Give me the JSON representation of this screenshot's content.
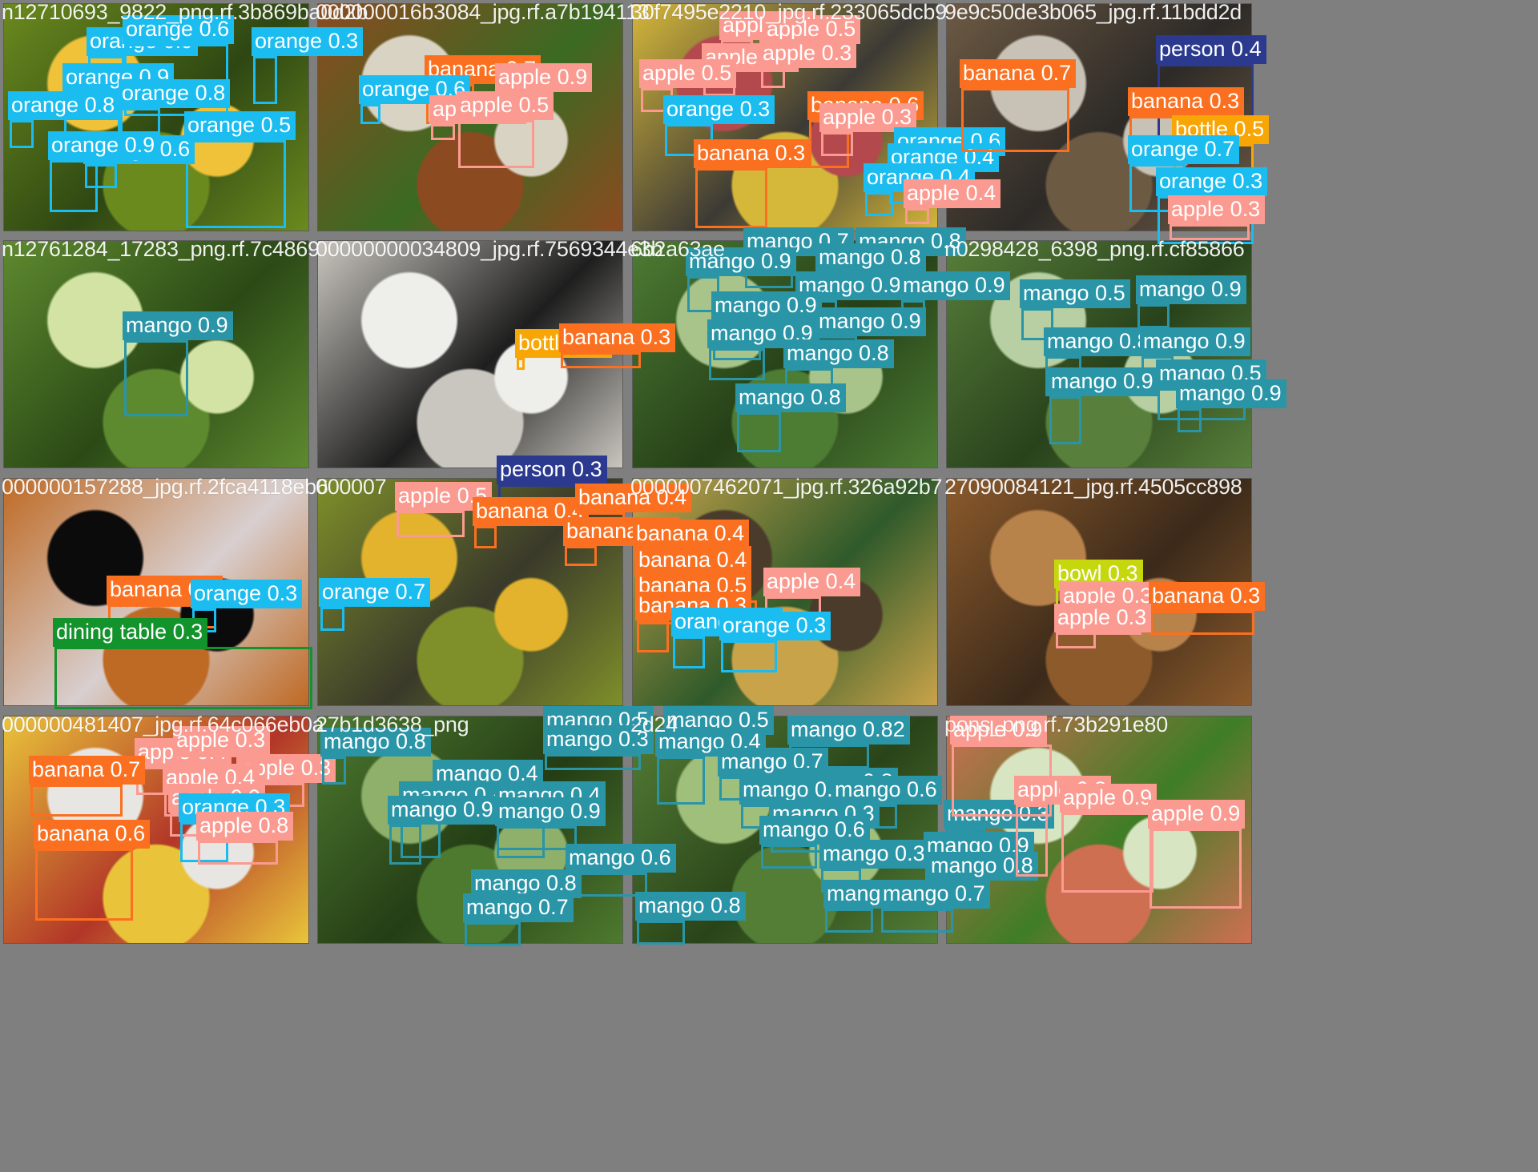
{
  "colors": {
    "orange": "#1bbcf0",
    "banana": "#fb7020",
    "apple": "#fb9a90",
    "mango": "#2a95a7",
    "person": "#2b3a8f",
    "bottle": "#f8a606",
    "bowl": "#c6d70e",
    "dining table": "#13932b"
  },
  "tiles": [
    {
      "filename": "n12710693_9822_png.rf.3b869ba0d2b",
      "photo": [
        "#f0c23a",
        "#6b8a1e",
        "#2e4713"
      ],
      "detections": [
        {
          "label": "orange 0.9",
          "cls": "orange"
        },
        {
          "label": "orange 0.3",
          "cls": "orange"
        },
        {
          "label": "orange 0.6",
          "cls": "orange"
        },
        {
          "label": "orange 0.9",
          "cls": "orange"
        },
        {
          "label": "orange 0.8",
          "cls": "orange"
        },
        {
          "label": "orange 0.8",
          "cls": "orange"
        },
        {
          "label": "orange 0.5",
          "cls": "orange"
        },
        {
          "label": "orange 0.6",
          "cls": "orange"
        },
        {
          "label": "orange 0.9",
          "cls": "orange"
        }
      ]
    },
    {
      "filename": "000000016b3084_jpg.rf.a7b194113",
      "photo": [
        "#d9d3c4",
        "#8c4a20",
        "#3b6a22"
      ],
      "detections": [
        {
          "label": "banana 0.7",
          "cls": "banana"
        },
        {
          "label": "orange 0.6",
          "cls": "orange"
        },
        {
          "label": "apple 0.4",
          "cls": "apple"
        },
        {
          "label": "apple 0.9",
          "cls": "apple"
        },
        {
          "label": "apple 0.5",
          "cls": "apple"
        }
      ]
    },
    {
      "filename": "30f7495e2210_jpg.rf.233065dcb9",
      "photo": [
        "#b4494d",
        "#d5b73a",
        "#3c3a35"
      ],
      "detections": [
        {
          "label": "apple 0.5",
          "cls": "apple"
        },
        {
          "label": "apple 0.5",
          "cls": "apple"
        },
        {
          "label": "apple 0.3",
          "cls": "apple"
        },
        {
          "label": "apple 0.3",
          "cls": "apple"
        },
        {
          "label": "apple 0.5",
          "cls": "apple"
        },
        {
          "label": "orange 0.3",
          "cls": "orange"
        },
        {
          "label": "banana 0.6",
          "cls": "banana"
        },
        {
          "label": "apple 0.3",
          "cls": "apple"
        },
        {
          "label": "banana 0.3",
          "cls": "banana"
        },
        {
          "label": "orange 0.6",
          "cls": "orange"
        },
        {
          "label": "orange 0.4",
          "cls": "orange"
        },
        {
          "label": "orange 0.4",
          "cls": "orange"
        },
        {
          "label": "apple 0.4",
          "cls": "apple"
        }
      ]
    },
    {
      "filename": "9e9c50de3b065_jpg.rf.11bdd2d",
      "photo": [
        "#c8c2b6",
        "#6d5a43",
        "#2d2a27"
      ],
      "detections": [
        {
          "label": "banana 0.7",
          "cls": "banana"
        },
        {
          "label": "person 0.4",
          "cls": "person"
        },
        {
          "label": "banana 0.3",
          "cls": "banana"
        },
        {
          "label": "bottle 0.5",
          "cls": "bottle"
        },
        {
          "label": "orange 0.7",
          "cls": "orange"
        },
        {
          "label": "orange 0.3",
          "cls": "orange"
        },
        {
          "label": "apple 0.3",
          "cls": "apple"
        }
      ]
    },
    {
      "filename": "n12761284_17283_png.rf.7c4869",
      "photo": [
        "#d2e3a4",
        "#5e8a2f",
        "#2b4a16"
      ],
      "detections": [
        {
          "label": "mango 0.9",
          "cls": "mango"
        }
      ]
    },
    {
      "filename": "00000000034809_jpg.rf.7569344e3b",
      "photo": [
        "#eeeeea",
        "#c9c6bf",
        "#1e1e1e"
      ],
      "detections": [
        {
          "label": "bottle 0.3",
          "cls": "bottle"
        },
        {
          "label": "banana 0.3",
          "cls": "banana"
        }
      ]
    },
    {
      "filename": "6b2a63ae",
      "photo": [
        "#a9c48a",
        "#4d7c33",
        "#253f17"
      ],
      "detections": [
        {
          "label": "mango 0.7",
          "cls": "mango"
        },
        {
          "label": "mango 0.8",
          "cls": "mango"
        },
        {
          "label": "mango 0.9",
          "cls": "mango"
        },
        {
          "label": "mango 0.8",
          "cls": "mango"
        },
        {
          "label": "mango 0.9",
          "cls": "mango"
        },
        {
          "label": "mango 0.9",
          "cls": "mango"
        },
        {
          "label": "mango 0.9",
          "cls": "mango"
        },
        {
          "label": "mango 0.9",
          "cls": "mango"
        },
        {
          "label": "mango 0.9",
          "cls": "mango"
        },
        {
          "label": "mango 0.8",
          "cls": "mango"
        },
        {
          "label": "mango 0.8",
          "cls": "mango"
        }
      ]
    },
    {
      "filename": "n0298428_6398_png.rf.cf85866",
      "photo": [
        "#b7cfa2",
        "#587f3b",
        "#28421b"
      ],
      "detections": [
        {
          "label": "mango 0.5",
          "cls": "mango"
        },
        {
          "label": "mango 0.9",
          "cls": "mango"
        },
        {
          "label": "mango 0.8",
          "cls": "mango"
        },
        {
          "label": "mango 0.9",
          "cls": "mango"
        },
        {
          "label": "mango 0.5",
          "cls": "mango"
        },
        {
          "label": "mango 0.9",
          "cls": "mango"
        },
        {
          "label": "mango 0.9",
          "cls": "mango"
        }
      ]
    },
    {
      "filename": "000000157288_jpg.rf.2fca4118eb6",
      "photo": [
        "#0b0b0b",
        "#bf6a24",
        "#d8cfcf"
      ],
      "detections": [
        {
          "label": "banana 0.4",
          "cls": "banana"
        },
        {
          "label": "orange 0.3",
          "cls": "orange"
        },
        {
          "label": "orange 0.7",
          "cls": "orange"
        },
        {
          "label": "dining table 0.3",
          "cls": "dining table"
        }
      ]
    },
    {
      "filename": "000007",
      "photo": [
        "#e3b32d",
        "#7f8f2a",
        "#3a3a2a"
      ],
      "detections": [
        {
          "label": "person 0.3",
          "cls": "person"
        },
        {
          "label": "apple 0.5",
          "cls": "apple"
        },
        {
          "label": "banana 0.4",
          "cls": "banana"
        },
        {
          "label": "banana 0.4",
          "cls": "banana"
        },
        {
          "label": "banana 0.5",
          "cls": "banana"
        }
      ]
    },
    {
      "filename": "0000007462071_jpg.rf.326a92b7",
      "photo": [
        "#4b3b2b",
        "#c9a34a",
        "#2f5a2a"
      ],
      "detections": [
        {
          "label": "banana 0.4",
          "cls": "banana"
        },
        {
          "label": "banana 0.4",
          "cls": "banana"
        },
        {
          "label": "banana 0.5",
          "cls": "banana"
        },
        {
          "label": "apple 0.4",
          "cls": "apple"
        },
        {
          "label": "banana 0.3",
          "cls": "banana"
        },
        {
          "label": "orange 0.3",
          "cls": "orange"
        },
        {
          "label": "orange 0.3",
          "cls": "orange"
        }
      ]
    },
    {
      "filename": "27090084121_jpg.rf.4505cc898",
      "photo": [
        "#b8824b",
        "#8c5a2b",
        "#3b2a1a"
      ],
      "detections": [
        {
          "label": "bowl 0.3",
          "cls": "bowl"
        },
        {
          "label": "apple 0.3",
          "cls": "apple"
        },
        {
          "label": "banana 0.3",
          "cls": "banana"
        },
        {
          "label": "apple 0.3",
          "cls": "apple"
        }
      ]
    },
    {
      "filename": "000000481407_jpg.rf.64c066eb0a",
      "photo": [
        "#e7e6e2",
        "#e9c43a",
        "#b23628"
      ],
      "detections": [
        {
          "label": "apple 0.4",
          "cls": "apple"
        },
        {
          "label": "apple 0.3",
          "cls": "apple"
        },
        {
          "label": "banana 0.7",
          "cls": "banana"
        },
        {
          "label": "apple 0.3",
          "cls": "apple"
        },
        {
          "label": "apple 0.4",
          "cls": "apple"
        },
        {
          "label": "apple 0.9",
          "cls": "apple"
        },
        {
          "label": "orange 0.3",
          "cls": "orange"
        },
        {
          "label": "apple 0.8",
          "cls": "apple"
        },
        {
          "label": "banana 0.6",
          "cls": "banana"
        }
      ]
    },
    {
      "filename": "27b1d3638_png",
      "photo": [
        "#8fb06b",
        "#4e7a2f",
        "#243d15"
      ],
      "detections": [
        {
          "label": "mango 0.5",
          "cls": "mango"
        },
        {
          "label": "mango 0.3",
          "cls": "mango"
        },
        {
          "label": "mango 0.8",
          "cls": "mango"
        },
        {
          "label": "mango 0.4",
          "cls": "mango"
        },
        {
          "label": "mango 0.4",
          "cls": "mango"
        },
        {
          "label": "mango 0.4",
          "cls": "mango"
        },
        {
          "label": "mango 0.9",
          "cls": "mango"
        },
        {
          "label": "mango 0.9",
          "cls": "mango"
        },
        {
          "label": "mango 0.6",
          "cls": "mango"
        },
        {
          "label": "mango 0.8",
          "cls": "mango"
        },
        {
          "label": "mango 0.7",
          "cls": "mango"
        }
      ]
    },
    {
      "filename": "2d24",
      "photo": [
        "#a0bf7a",
        "#547e36",
        "#2a4419"
      ],
      "detections": [
        {
          "label": "mango 0.5",
          "cls": "mango"
        },
        {
          "label": "mango 0.82",
          "cls": "mango"
        },
        {
          "label": "mango 0.4",
          "cls": "mango"
        },
        {
          "label": "mango 0.7",
          "cls": "mango"
        },
        {
          "label": "mango 0.8",
          "cls": "mango"
        },
        {
          "label": "mango 0.4",
          "cls": "mango"
        },
        {
          "label": "mango 0.6",
          "cls": "mango"
        },
        {
          "label": "mango 0.3",
          "cls": "mango"
        },
        {
          "label": "mango 0.3",
          "cls": "mango"
        },
        {
          "label": "mango 0.6",
          "cls": "mango"
        },
        {
          "label": "mango 0.3",
          "cls": "mango"
        },
        {
          "label": "mango 0.9",
          "cls": "mango"
        },
        {
          "label": "mango 0.8",
          "cls": "mango"
        },
        {
          "label": "mango 0.8",
          "cls": "mango"
        },
        {
          "label": "mango 0.6",
          "cls": "mango"
        },
        {
          "label": "mango 0.7",
          "cls": "mango"
        }
      ]
    },
    {
      "filename": "pons_png.rf.73b291e80",
      "photo": [
        "#d7e5c2",
        "#cf6f52",
        "#3f7d26"
      ],
      "detections": [
        {
          "label": "apple 0.9",
          "cls": "apple"
        },
        {
          "label": "apple 0.8",
          "cls": "apple"
        },
        {
          "label": "apple 0.9",
          "cls": "apple"
        },
        {
          "label": "apple 0.9",
          "cls": "apple"
        }
      ]
    }
  ]
}
